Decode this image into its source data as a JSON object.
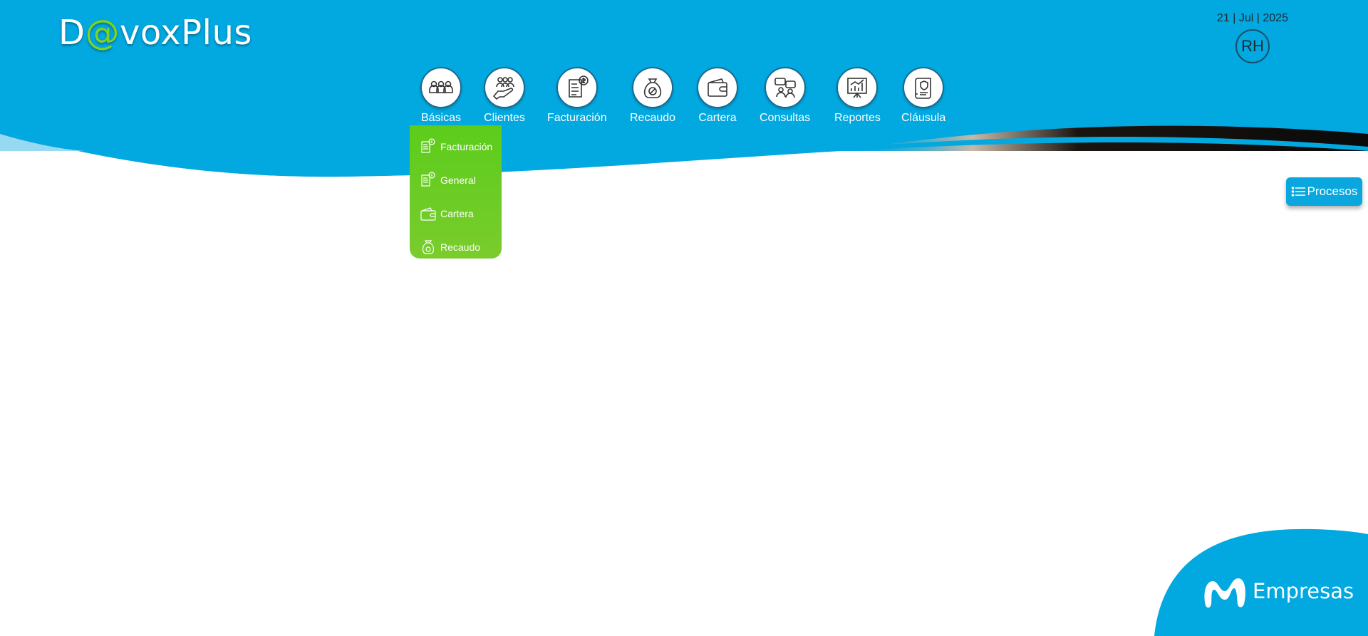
{
  "header": {
    "logo": {
      "prefix": "D",
      "at": "@",
      "suffix": "voxPlus"
    },
    "date": "21 | Jul | 2025",
    "avatar_initials": "RH"
  },
  "nav": {
    "items": [
      {
        "label": "Básicas",
        "icon": "users-group-icon"
      },
      {
        "label": "Clientes",
        "icon": "hand-users-icon"
      },
      {
        "label": "Facturación",
        "icon": "invoice-dollar-icon"
      },
      {
        "label": "Recaudo",
        "icon": "money-bag-icon"
      },
      {
        "label": "Cartera",
        "icon": "wallet-icon"
      },
      {
        "label": "Consultas",
        "icon": "chat-users-icon"
      },
      {
        "label": "Reportes",
        "icon": "chart-board-icon"
      },
      {
        "label": "Cláusula",
        "icon": "scroll-shield-icon"
      }
    ]
  },
  "dropdown": {
    "items": [
      {
        "label": "Facturación",
        "icon": "invoice-dollar-icon"
      },
      {
        "label": "General",
        "icon": "invoice-dollar-icon"
      },
      {
        "label": "Cartera",
        "icon": "wallet-icon"
      },
      {
        "label": "Recaudo",
        "icon": "money-bag-icon"
      }
    ]
  },
  "procesos": {
    "label": "Procesos",
    "icon": "list-icon"
  },
  "footer": {
    "brand_text": "Empresas",
    "brand_icon": "movistar-m-icon"
  },
  "colors": {
    "header_blue": "#02a8e0",
    "accent_green": "#7ed321",
    "dropdown_green": "#5ccc1c"
  }
}
